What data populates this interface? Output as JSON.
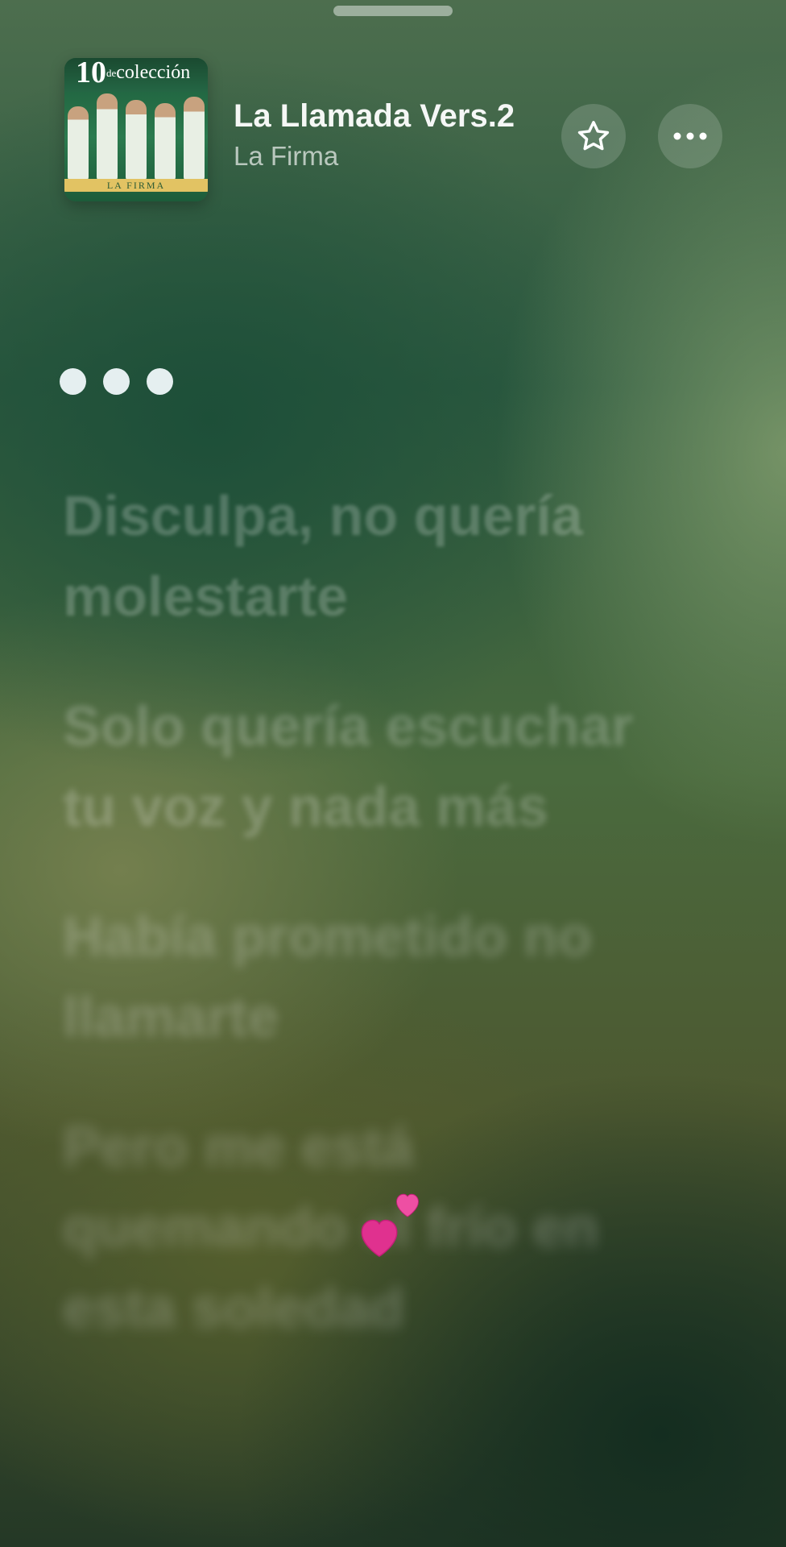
{
  "header": {
    "song_title": "La Llamada Vers.2",
    "artist": "La Firma",
    "album_art": {
      "number": "10",
      "small_text": "de",
      "collection_text": "colección",
      "brand": "LA FIRMA"
    },
    "favorite_icon": "star-icon",
    "more_icon": "ellipsis-icon"
  },
  "instrumental_indicator": {
    "dots": 3
  },
  "lyrics": [
    "Disculpa, no quería molestarte",
    "Solo quería escuchar tu voz y nada más",
    "Había prometido no llamarte",
    "Pero me está quemando el frío en esta soledad"
  ],
  "reaction": {
    "icon": "two-hearts-icon",
    "color": "#e0318f"
  },
  "colors": {
    "background_green": "#2d5a40",
    "background_olive": "#4d5830",
    "text_primary": "#ffffff"
  }
}
